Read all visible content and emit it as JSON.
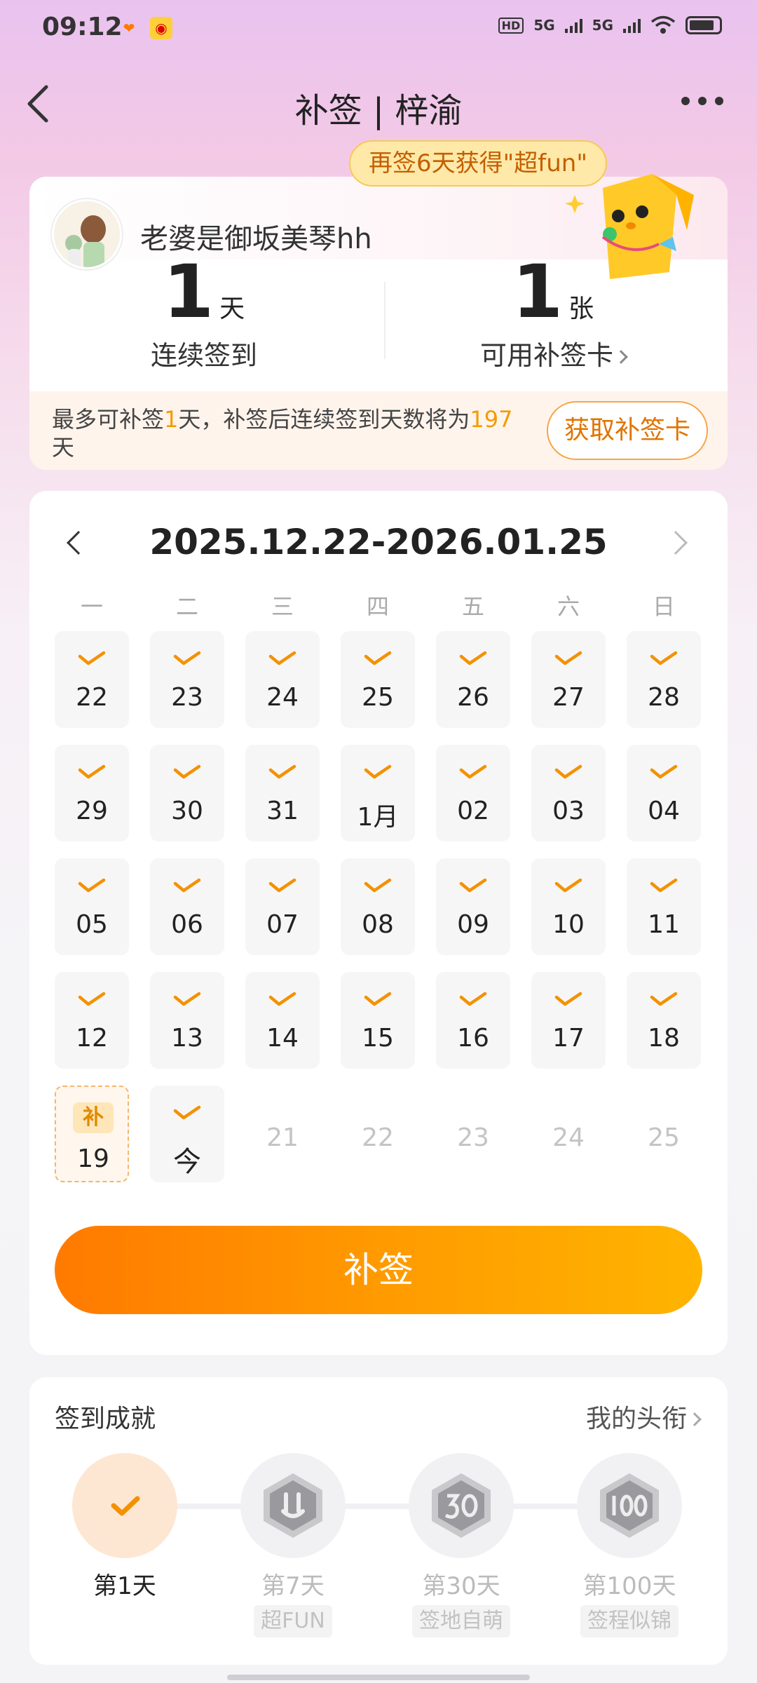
{
  "status_bar": {
    "time": "09:12",
    "network": "5G",
    "network2": "5G"
  },
  "header": {
    "title": "补签 | 梓渝"
  },
  "promo": {
    "text": "再签6天获得\"超fun\""
  },
  "profile": {
    "username": "老婆是御坂美琴hh",
    "streak_value": "1",
    "streak_unit": "天",
    "streak_label": "连续签到",
    "cards_value": "1",
    "cards_unit": "张",
    "cards_label": "可用补签卡",
    "makeup_text_part1": "最多可补签",
    "makeup_days": "1",
    "makeup_text_part2": "天，补签后连续签到天数将为",
    "makeup_total": "197",
    "makeup_text_part3": "天",
    "get_card_button": "获取补签卡"
  },
  "calendar": {
    "range": "2025.12.22-2026.01.25",
    "weekdays": [
      "一",
      "二",
      "三",
      "四",
      "五",
      "六",
      "日"
    ],
    "weeks": [
      [
        "22",
        "23",
        "24",
        "25",
        "26",
        "27",
        "28"
      ],
      [
        "29",
        "30",
        "31",
        "1月",
        "02",
        "03",
        "04"
      ],
      [
        "05",
        "06",
        "07",
        "08",
        "09",
        "10",
        "11"
      ],
      [
        "12",
        "13",
        "14",
        "15",
        "16",
        "17",
        "18"
      ],
      [
        "19",
        "今",
        "21",
        "22",
        "23",
        "24",
        "25"
      ]
    ],
    "makeup_badge": "补",
    "button": "补签"
  },
  "achievements": {
    "title": "签到成就",
    "link": "我的头衔",
    "items": [
      {
        "label": "第1天",
        "tag": ""
      },
      {
        "label": "第7天",
        "tag": "超FUN"
      },
      {
        "label": "第30天",
        "tag": "签地自萌"
      },
      {
        "label": "第100天",
        "tag": "签程似锦"
      }
    ]
  },
  "colors": {
    "accent": "#ff8a00",
    "check": "#f39200",
    "future_text": "#c4c4c4"
  }
}
